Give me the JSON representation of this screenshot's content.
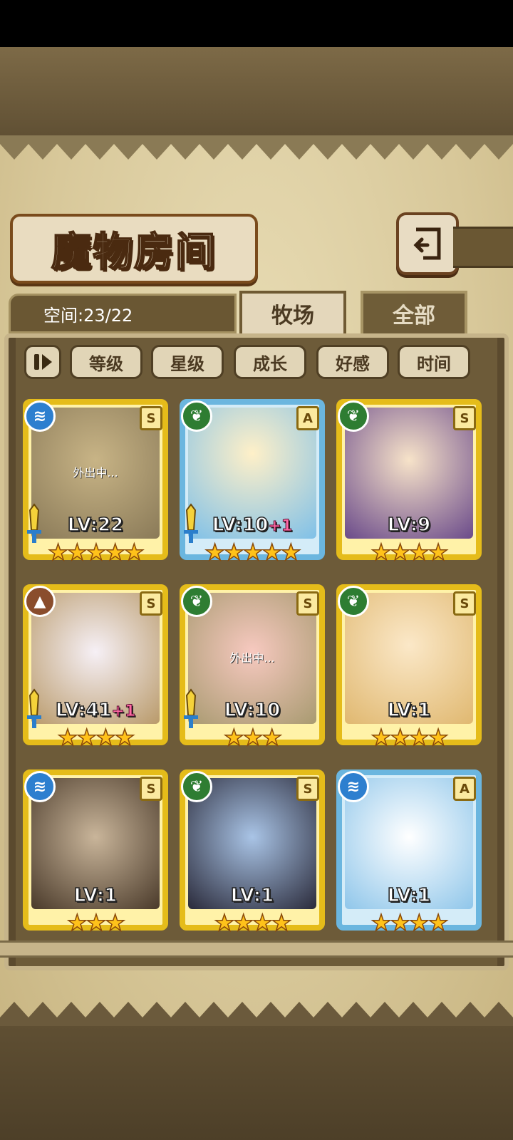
{
  "title": "魔物房间",
  "space": {
    "text": "空间:23/22"
  },
  "tabs": [
    {
      "label": "牧场",
      "active": true
    },
    {
      "label": "全部",
      "active": false
    }
  ],
  "sort_buttons": [
    {
      "icon": "pause-sort-icon"
    },
    {
      "label": "等级"
    },
    {
      "label": "星级"
    },
    {
      "label": "成长"
    },
    {
      "label": "好感"
    },
    {
      "label": "时间"
    }
  ],
  "monsters": [
    {
      "element": "water",
      "rank": "S",
      "level": "LV:22",
      "bonus": "",
      "stars": "★★★★★",
      "status": "外出中...",
      "frame": "gold",
      "weapon": true
    },
    {
      "element": "plant",
      "rank": "A",
      "level": "LV:10",
      "bonus": "+1",
      "stars": "★★★★★",
      "status": "",
      "frame": "blue",
      "weapon": true
    },
    {
      "element": "plant",
      "rank": "S",
      "level": "LV:9",
      "bonus": "",
      "stars": "★★★★",
      "status": "",
      "frame": "gold",
      "weapon": false
    },
    {
      "element": "earth",
      "rank": "S",
      "level": "LV:41",
      "bonus": "+1",
      "stars": "★★★★",
      "status": "",
      "frame": "gold",
      "weapon": true
    },
    {
      "element": "plant",
      "rank": "S",
      "level": "LV:10",
      "bonus": "",
      "stars": "★★★",
      "status": "外出中...",
      "frame": "gold",
      "weapon": true
    },
    {
      "element": "plant",
      "rank": "S",
      "level": "LV:1",
      "bonus": "",
      "stars": "★★★★",
      "status": "",
      "frame": "gold",
      "weapon": false
    },
    {
      "element": "water",
      "rank": "S",
      "level": "LV:1",
      "bonus": "",
      "stars": "★★★",
      "status": "",
      "frame": "gold",
      "weapon": false
    },
    {
      "element": "plant",
      "rank": "S",
      "level": "LV:1",
      "bonus": "",
      "stars": "★★★★",
      "status": "",
      "frame": "gold",
      "weapon": false
    },
    {
      "element": "water",
      "rank": "A",
      "level": "LV:1",
      "bonus": "",
      "stars": "★★★★",
      "status": "",
      "frame": "blue",
      "weapon": false
    }
  ],
  "colors": {
    "gold_frame": "#e5bc1a",
    "blue_frame": "#6bb6df",
    "star": "#ffc21a",
    "panel": "#6d5b39"
  }
}
